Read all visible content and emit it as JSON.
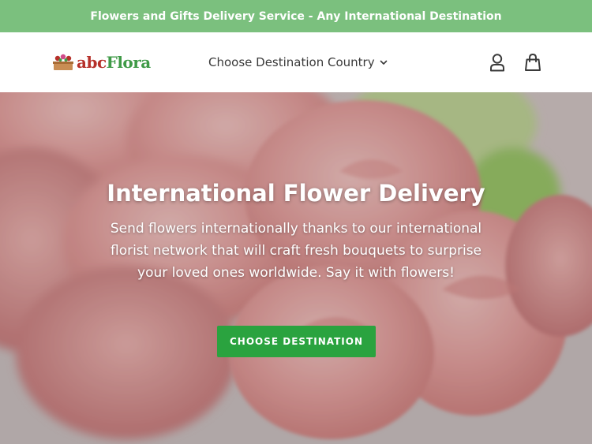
{
  "announcement": {
    "text": "Flowers and Gifts Delivery Service - Any International Destination"
  },
  "header": {
    "logo": {
      "part1": "abc",
      "part2": "Flora"
    },
    "nav": {
      "destination_label": "Choose Destination Country"
    },
    "icons": [
      "account-icon",
      "cart-icon",
      "chevron-down-icon"
    ]
  },
  "hero": {
    "title": "International Flower Delivery",
    "text": "Send flowers internationally thanks to our international florist network that will craft fresh bouquets to surprise your loved ones worldwide. Say it with flowers!",
    "button_label": "CHOOSE DESTINATION"
  },
  "colors": {
    "announcement_bg": "#7bc07e",
    "button_bg": "#2aa33f",
    "logo_red": "#b6302a",
    "logo_green": "#3f9a47"
  }
}
